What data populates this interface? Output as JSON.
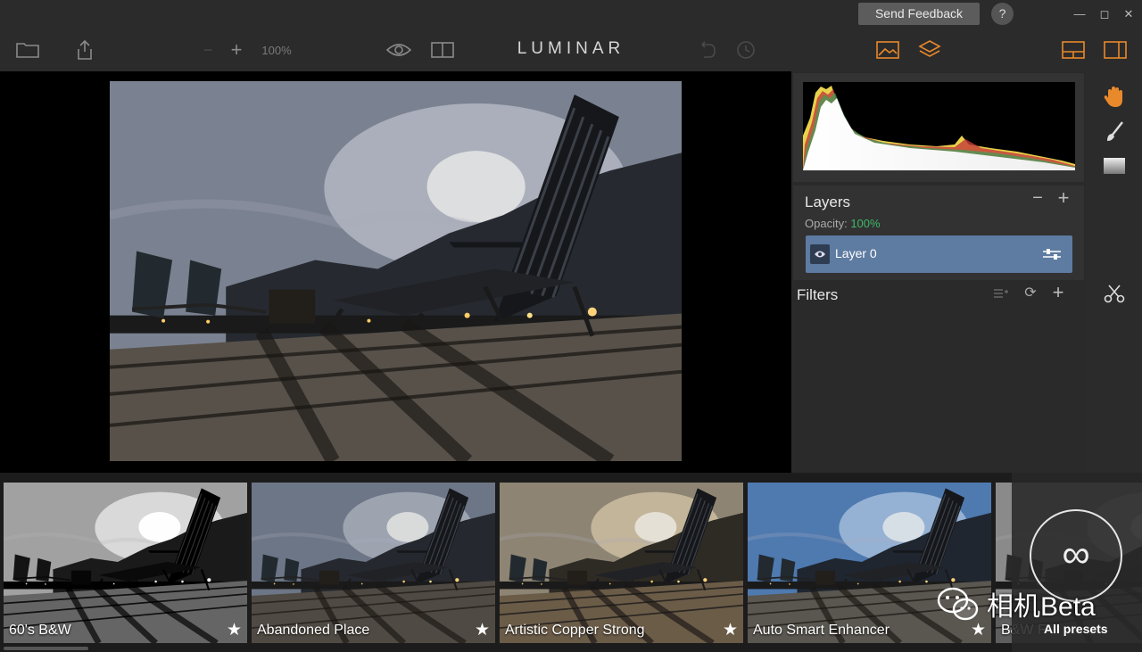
{
  "titlebar": {
    "feedback_label": "Send Feedback",
    "help_label": "?",
    "minimize": "—",
    "maximize": "◻",
    "close": "✕"
  },
  "toolbar": {
    "zoom_level": "100%",
    "brand": "LUMINAR",
    "accent_color": "#e8892b"
  },
  "layers": {
    "title": "Layers",
    "opacity_label": "Opacity:",
    "opacity_value": "100%",
    "items": [
      {
        "name": "Layer 0"
      }
    ]
  },
  "filters": {
    "title": "Filters"
  },
  "presets": [
    {
      "label": "60's B&W",
      "style": "bw"
    },
    {
      "label": "Abandoned Place",
      "style": "cool"
    },
    {
      "label": "Artistic Copper Strong",
      "style": "warm"
    },
    {
      "label": "Auto Smart Enhancer",
      "style": "blue"
    },
    {
      "label": "B&W F",
      "style": "bw"
    }
  ],
  "all_presets": {
    "icon": "∞",
    "label": "All presets"
  },
  "watermark": {
    "text": "相机Beta"
  }
}
